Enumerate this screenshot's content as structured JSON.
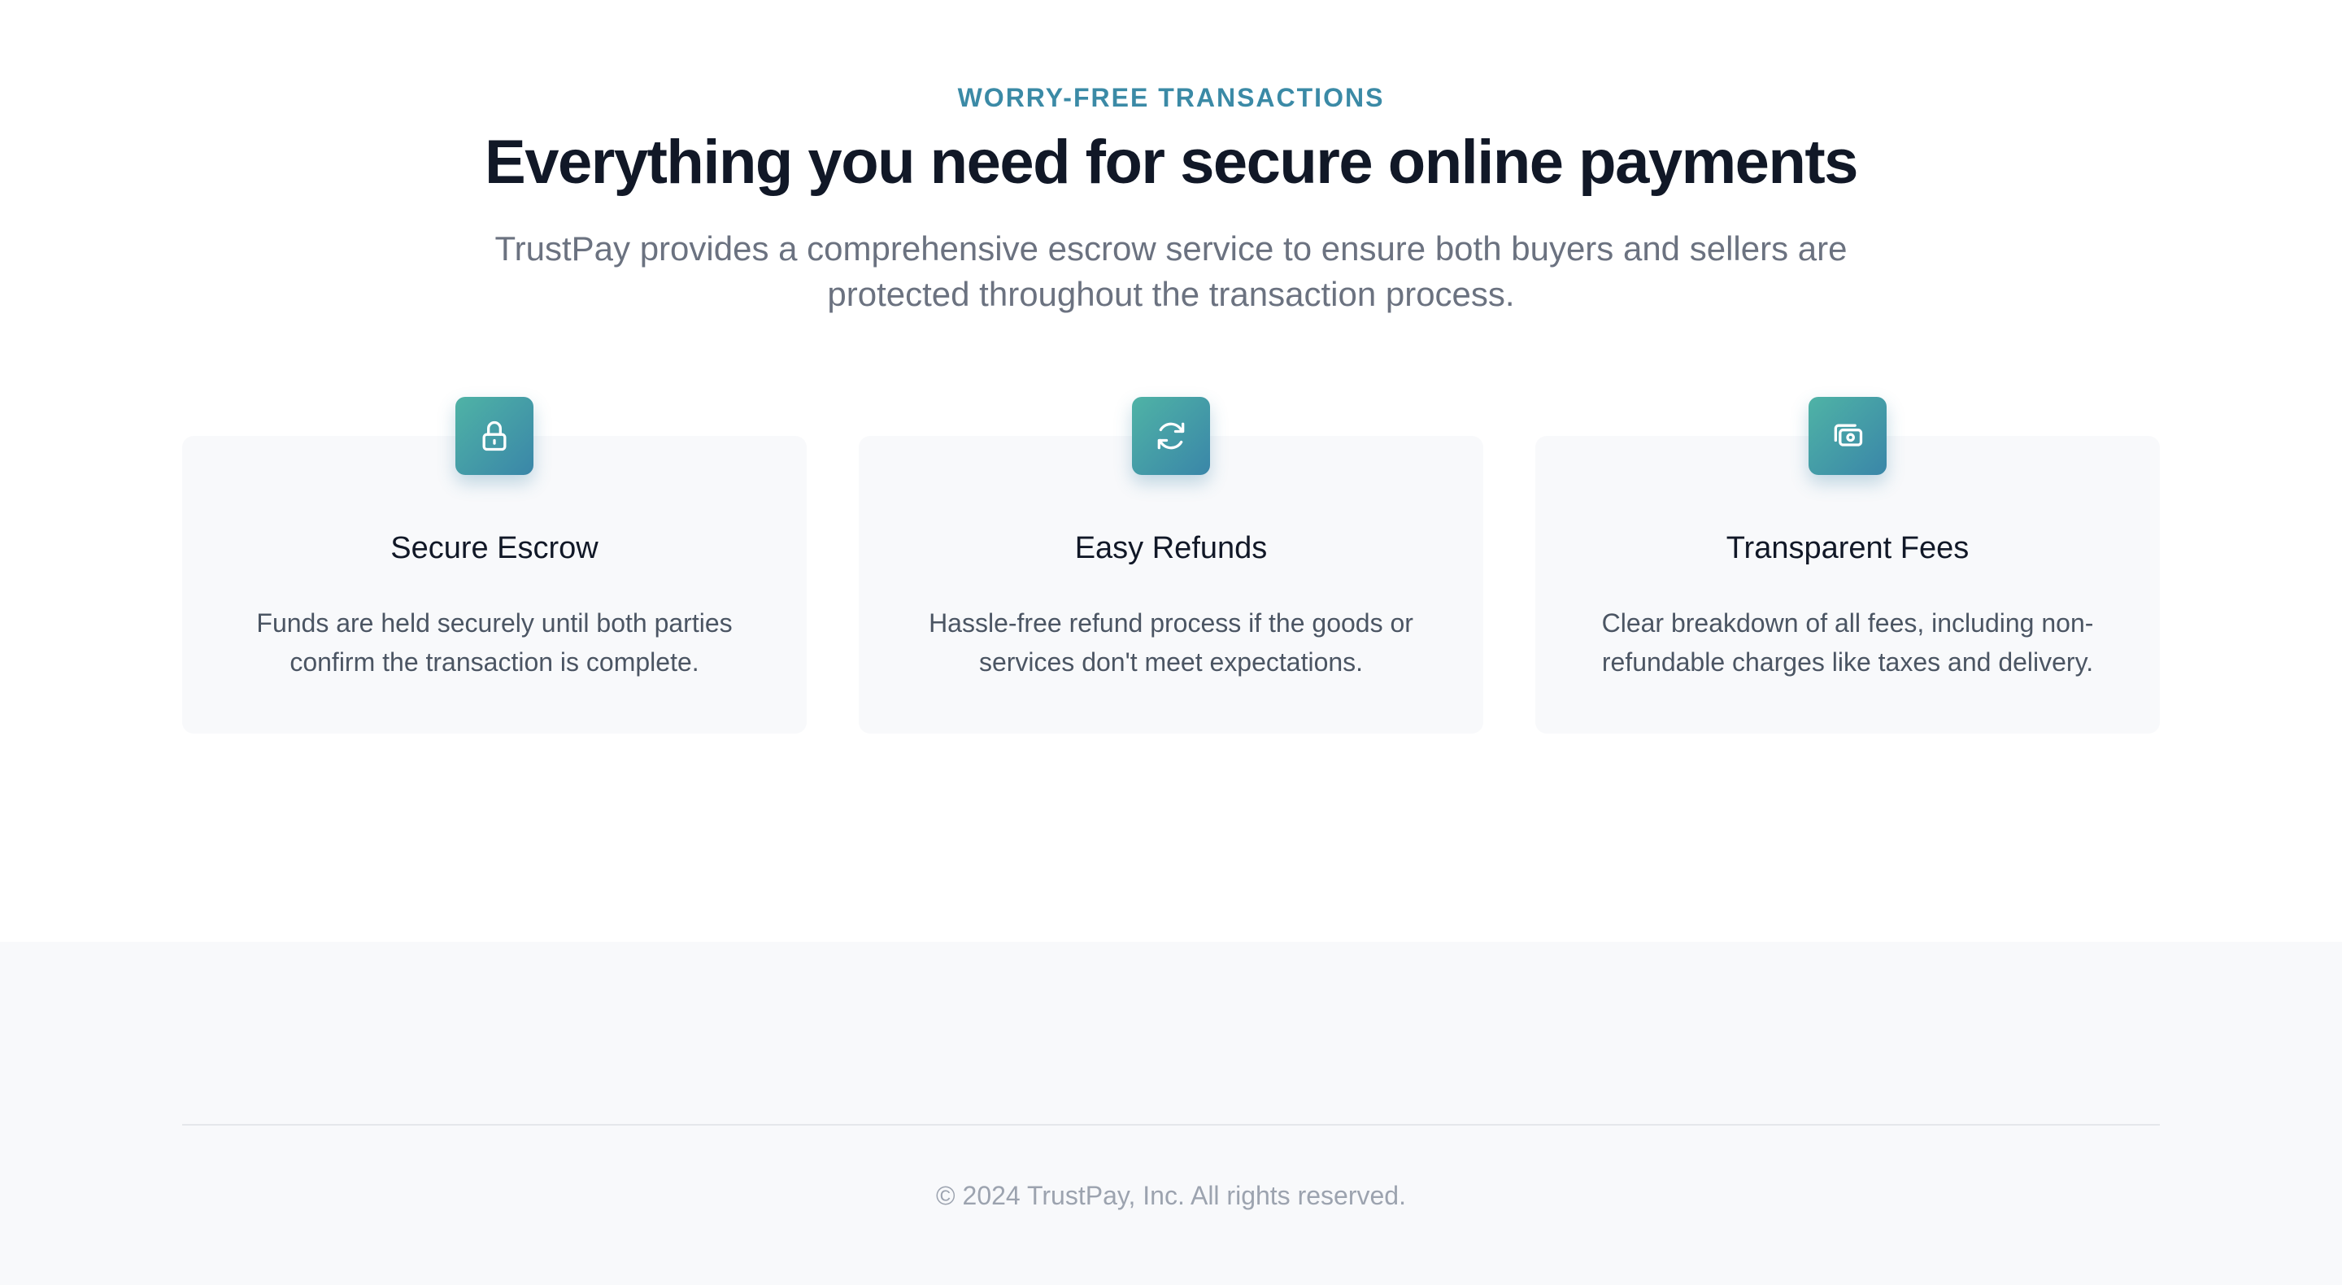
{
  "section": {
    "eyebrow": "WORRY-FREE TRANSACTIONS",
    "headline": "Everything you need for secure online payments",
    "lead": "TrustPay provides a comprehensive escrow service to ensure both buyers and sellers are protected throughout the transaction process."
  },
  "features": [
    {
      "icon": "lock-icon",
      "title": "Secure Escrow",
      "description": "Funds are held securely until both parties confirm the transaction is complete."
    },
    {
      "icon": "refresh-icon",
      "title": "Easy Refunds",
      "description": "Hassle-free refund process if the goods or services don't meet expectations."
    },
    {
      "icon": "cash-icon",
      "title": "Transparent Fees",
      "description": "Clear breakdown of all fees, including non-refundable charges like taxes and delivery."
    }
  ],
  "footer": {
    "copyright": "© 2024 TrustPay, Inc. All rights reserved."
  },
  "colors": {
    "accent": "#3b8aa6",
    "icon_gradient_start": "#4fb3a6",
    "icon_gradient_end": "#3a86a8",
    "heading": "#111827",
    "body_text": "#6b7280",
    "card_background": "#f8f9fb"
  }
}
